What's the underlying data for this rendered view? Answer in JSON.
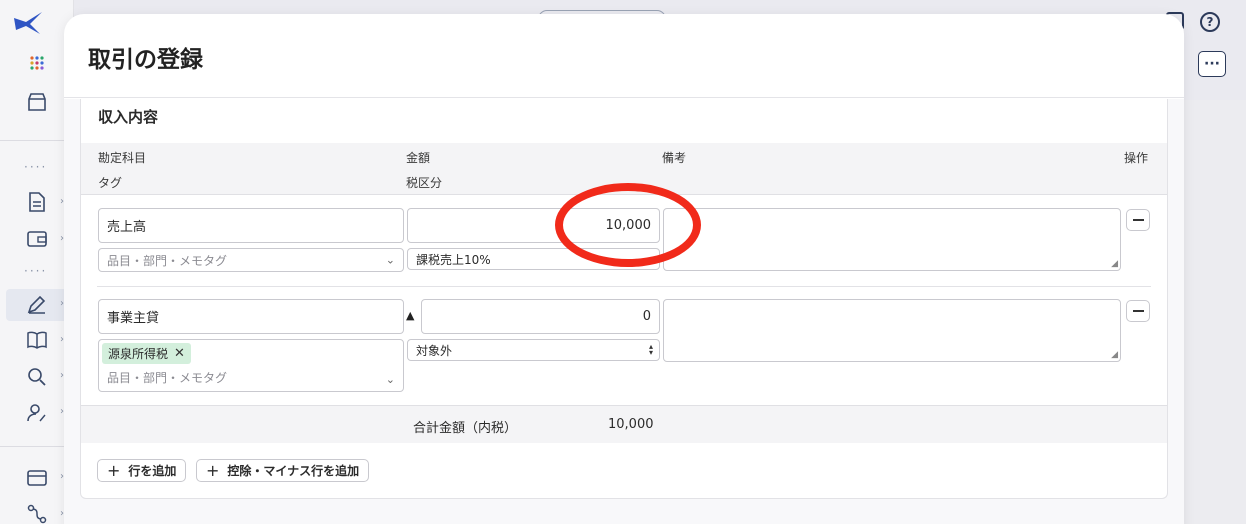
{
  "modal": {
    "title": "取引の登録",
    "section_title": "収入内容",
    "columns": {
      "account": "勘定科目",
      "amount": "金額",
      "remarks": "備考",
      "actions": "操作",
      "tag": "タグ",
      "tax_category": "税区分"
    },
    "rows": [
      {
        "account": "売上高",
        "tag_placeholder": "品目・部門・メモタグ",
        "amount": "10,000",
        "tax_category": "課税売上10%",
        "remarks": ""
      },
      {
        "account": "事業主貸",
        "sign": "▲",
        "tag_chip": "源泉所得税",
        "tag_placeholder": "品目・部門・メモタグ",
        "amount": "0",
        "tax_category": "対象外",
        "remarks": ""
      }
    ],
    "total_label": "合計金額（内税）",
    "total_value": "10,000",
    "add_row_label": "行を追加",
    "add_deduction_label": "控除・マイナス行を追加"
  },
  "colors": {
    "highlight": "#f12a1a",
    "tag_chip": "#d3efdc"
  }
}
